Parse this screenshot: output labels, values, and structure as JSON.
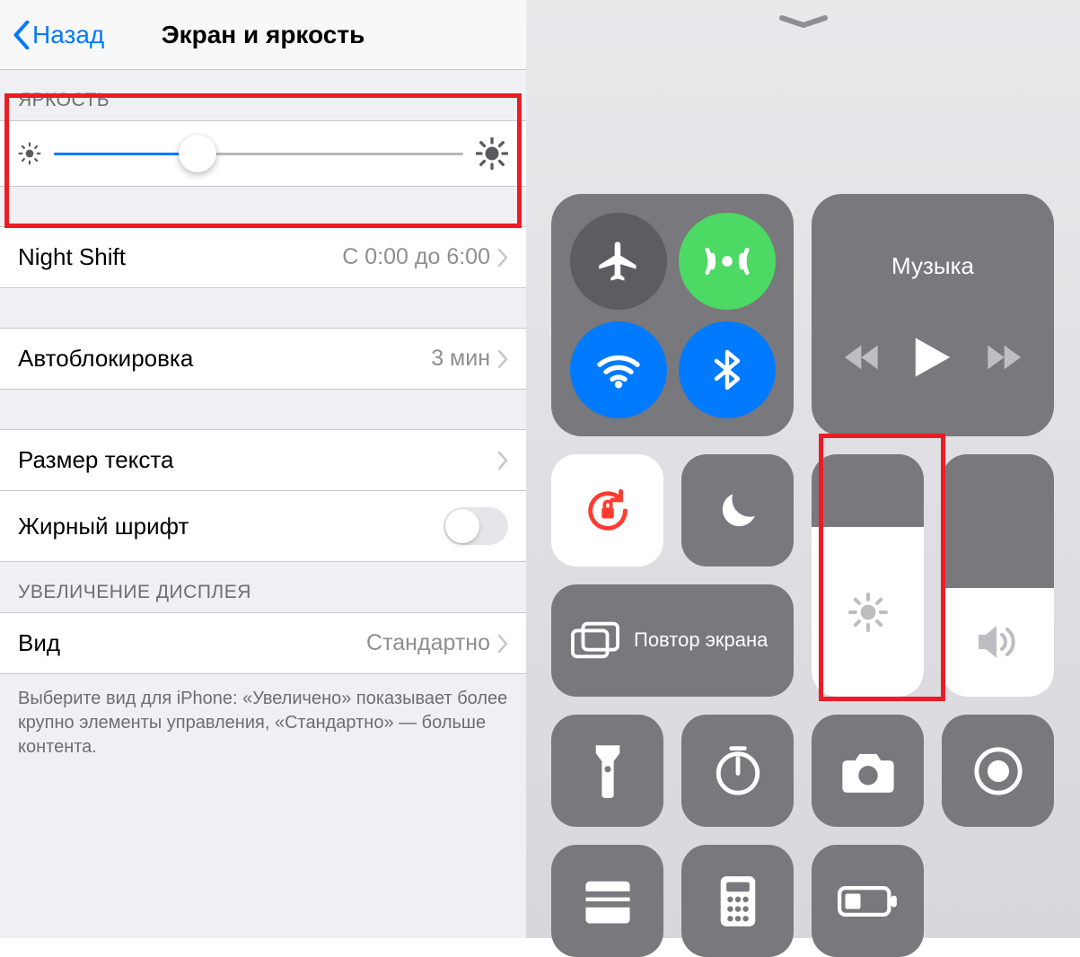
{
  "settings": {
    "back_label": "Назад",
    "title": "Экран и яркость",
    "brightness_section": "ЯРКОСТЬ",
    "brightness_percent": 35,
    "night_shift": {
      "label": "Night Shift",
      "value": "С 0:00 до 6:00"
    },
    "auto_lock": {
      "label": "Автоблокировка",
      "value": "3 мин"
    },
    "text_size": {
      "label": "Размер текста"
    },
    "bold_text": {
      "label": "Жирный шрифт",
      "on": false
    },
    "zoom_section": "УВЕЛИЧЕНИЕ ДИСПЛЕЯ",
    "view": {
      "label": "Вид",
      "value": "Стандартно"
    },
    "footnote": "Выберите вид для iPhone: «Увеличено» показывает более крупно элементы управления, «Стандартно» — больше контента."
  },
  "control_center": {
    "music_label": "Музыка",
    "screen_mirror_label": "Повтор экрана",
    "brightness_percent": 70,
    "volume_percent": 45
  }
}
